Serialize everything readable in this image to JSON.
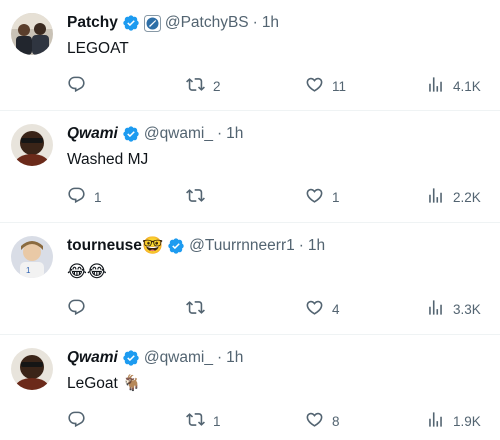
{
  "tweets": [
    {
      "name": "Patchy",
      "handle": "@PatchyBS",
      "time": "1h",
      "text": "LEGOAT",
      "replies": "",
      "retweets": "2",
      "likes": "11",
      "views": "4.1K"
    },
    {
      "name": "Qwami",
      "handle": "@qwami_",
      "time": "1h",
      "text": "Washed MJ",
      "replies": "1",
      "retweets": "",
      "likes": "1",
      "views": "2.2K"
    },
    {
      "name": "tourneuse",
      "name_emoji": "🤓",
      "handle": "@Tuurrnneerr1",
      "time": "1h",
      "text": "😂😂",
      "replies": "",
      "retweets": "",
      "likes": "4",
      "views": "3.3K"
    },
    {
      "name": "Qwami",
      "handle": "@qwami_",
      "time": "1h",
      "text": "LeGoat 🐐",
      "replies": "",
      "retweets": "1",
      "likes": "8",
      "views": "1.9K"
    }
  ],
  "colors": {
    "verified_blue": "#1d9bf0",
    "muted_text": "#536471",
    "divider": "#eff3f4"
  },
  "icons": {
    "verified": "verified-badge-icon",
    "reply": "reply-icon",
    "retweet": "retweet-icon",
    "like": "heart-icon",
    "views": "views-bar-chart-icon",
    "affiliate": "affiliate-badge-icon"
  }
}
